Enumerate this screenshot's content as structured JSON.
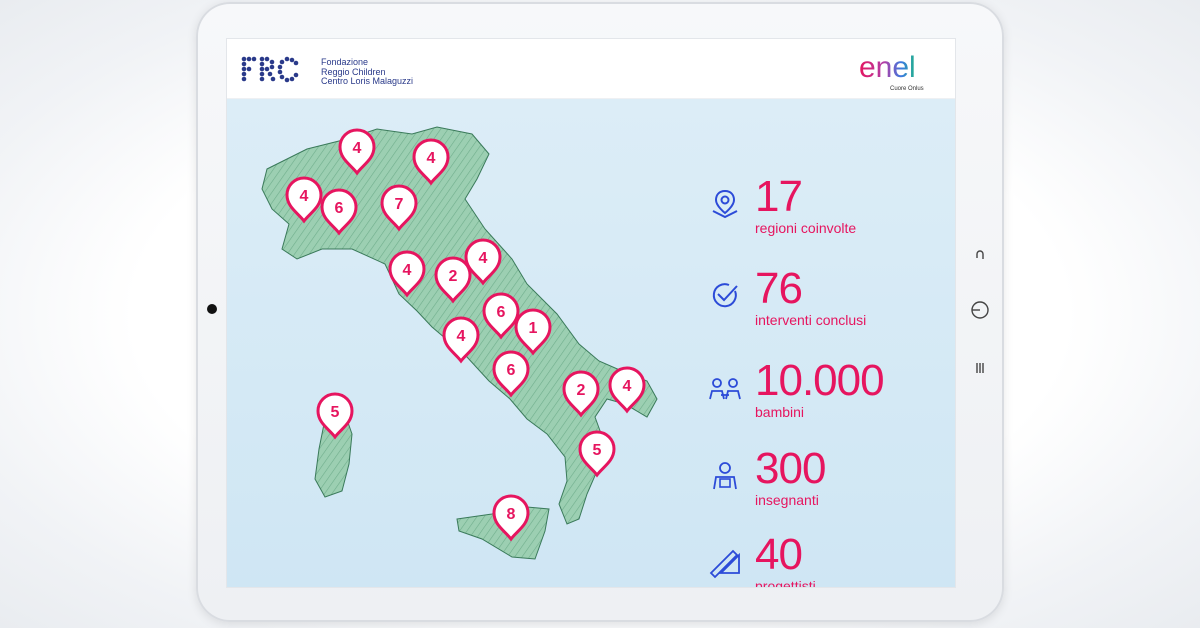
{
  "header": {
    "frc_logo_text": "FRC",
    "frc_name_lines": [
      "Fondazione",
      "Reggio Children",
      "Centro Loris Malaguzzi"
    ],
    "enel_logo_text": "enel",
    "enel_sub": "Cuore Onlus"
  },
  "stats": [
    {
      "value": "17",
      "label": "regioni coinvolte",
      "icon": "location-icon"
    },
    {
      "value": "76",
      "label": "interventi conclusi",
      "icon": "check-circle-icon"
    },
    {
      "value": "10.000",
      "label": "bambini",
      "icon": "children-icon"
    },
    {
      "value": "300",
      "label": "insegnanti",
      "icon": "teacher-icon"
    },
    {
      "value": "40",
      "label": "progettisti",
      "icon": "pencil-ruler-icon"
    }
  ],
  "map_pins": [
    "4",
    "4",
    "4",
    "6",
    "7",
    "4",
    "2",
    "4",
    "6",
    "4",
    "1",
    "6",
    "2",
    "4",
    "5",
    "5",
    "8"
  ],
  "colors": {
    "accent": "#e6155f",
    "icon_blue": "#2c4bd8",
    "map_fill": "#8fc9a8"
  }
}
